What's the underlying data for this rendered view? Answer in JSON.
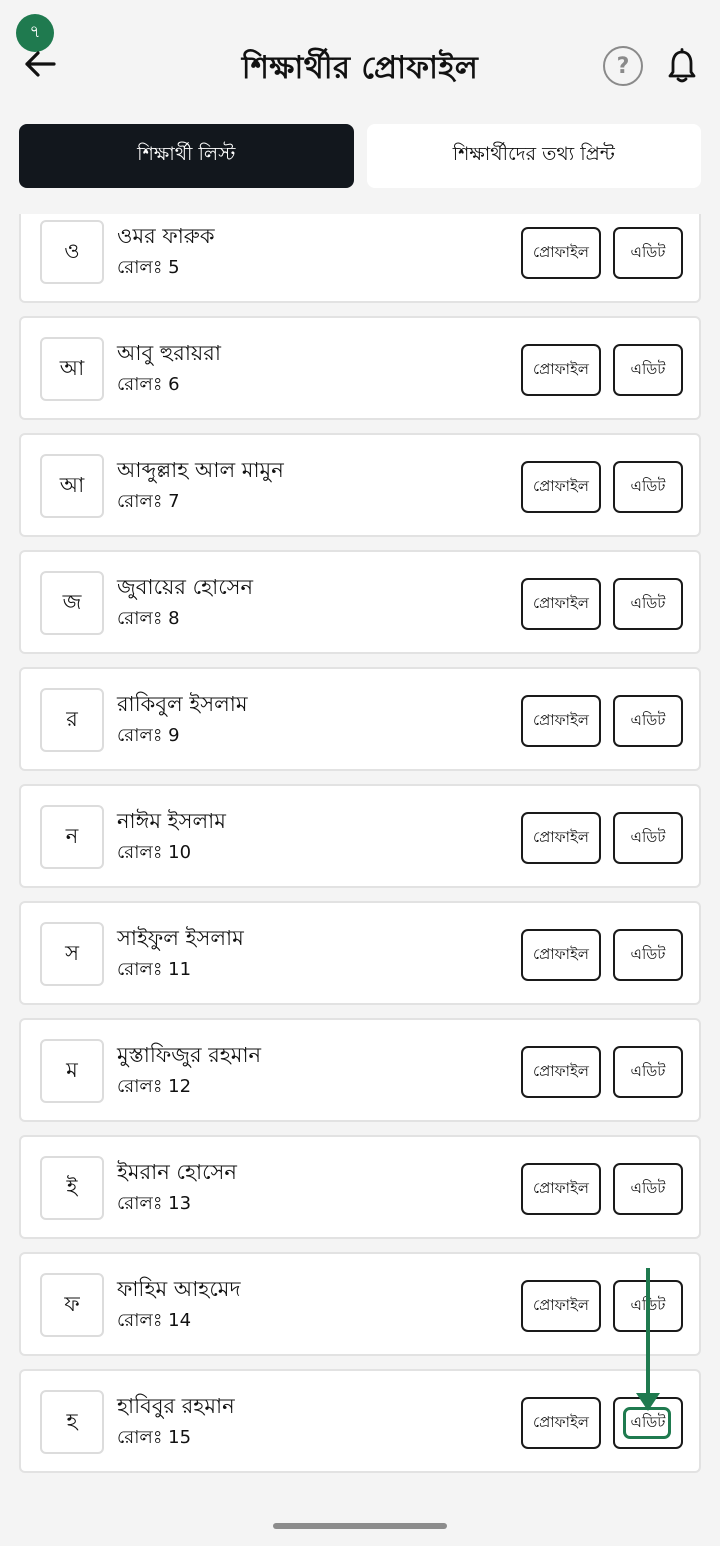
{
  "step_badge": "৭",
  "header": {
    "title": "শিক্ষার্থীর প্রোফাইল",
    "help_glyph": "?",
    "back_icon": "arrow-left-icon",
    "help_icon": "question-circle-icon",
    "bell_icon": "bell-icon"
  },
  "tabs": [
    {
      "label": "শিক্ষার্থী লিস্ট",
      "active": true
    },
    {
      "label": "শিক্ষার্থীদের তথ্য প্রিন্ট",
      "active": false
    }
  ],
  "buttons": {
    "profile": "প্রোফাইল",
    "edit": "এডিট"
  },
  "students": [
    {
      "initial": "ও",
      "name": "ওমর ফারুক",
      "roll": "রোলঃ 5"
    },
    {
      "initial": "আ",
      "name": "আবু হুরায়রা",
      "roll": "রোলঃ 6"
    },
    {
      "initial": "আ",
      "name": "আব্দুল্লাহ আল মামুন",
      "roll": "রোলঃ 7"
    },
    {
      "initial": "জ",
      "name": "জুবায়ের হোসেন",
      "roll": "রোলঃ 8"
    },
    {
      "initial": "র",
      "name": "রাকিবুল ইসলাম",
      "roll": "রোলঃ 9"
    },
    {
      "initial": "ন",
      "name": "নাঈম ইসলাম",
      "roll": "রোলঃ 10"
    },
    {
      "initial": "স",
      "name": "সাইফুল ইসলাম",
      "roll": "রোলঃ 11"
    },
    {
      "initial": "ম",
      "name": "মুস্তাফিজুর রহমান",
      "roll": "রোলঃ 12"
    },
    {
      "initial": "ই",
      "name": "ইমরান হোসেন",
      "roll": "রোলঃ 13"
    },
    {
      "initial": "ফ",
      "name": "ফাহিম আহমেদ",
      "roll": "রোলঃ 14"
    },
    {
      "initial": "হ",
      "name": "হাবিবুর রহমান",
      "roll": "রোলঃ 15"
    }
  ],
  "colors": {
    "accent": "#1f7a4f",
    "active_tab": "#12171d",
    "background": "#f4f4f4"
  }
}
